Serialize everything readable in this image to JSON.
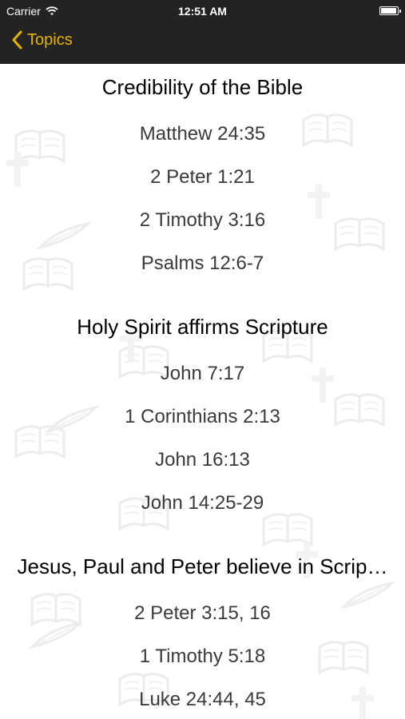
{
  "status": {
    "carrier": "Carrier",
    "time": "12:51 AM"
  },
  "nav": {
    "back_label": "Topics"
  },
  "colors": {
    "accent": "#e5b400",
    "bar": "#232323"
  },
  "sections": [
    {
      "title": "Credibility of the Bible",
      "verses": [
        "Matthew 24:35",
        "2 Peter 1:21",
        "2 Timothy 3:16",
        "Psalms 12:6-7"
      ]
    },
    {
      "title": "Holy Spirit affirms Scripture",
      "verses": [
        "John 7:17",
        "1 Corinthians 2:13",
        "John 16:13",
        "John 14:25-29"
      ]
    },
    {
      "title": "Jesus, Paul and Peter believe in Scrip…",
      "verses": [
        "2 Peter 3:15, 16",
        "1 Timothy 5:18",
        "Luke 24:44, 45"
      ]
    }
  ]
}
